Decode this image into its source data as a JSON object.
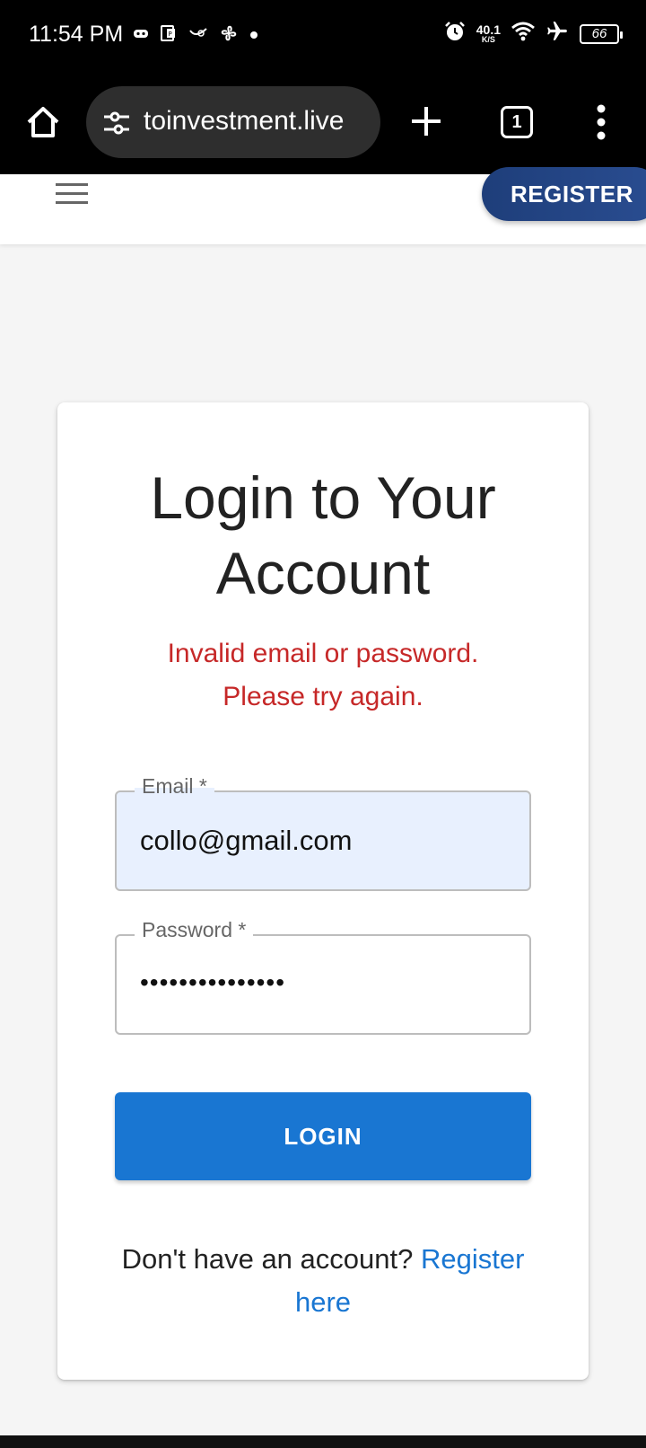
{
  "status_bar": {
    "time": "11:54 PM",
    "net_speed_value": "40.1",
    "net_speed_unit": "K/S",
    "battery": "66",
    "icons": [
      "game-icon",
      "pdf-icon",
      "whatsapp-icon",
      "fan-icon",
      "dot-icon",
      "alarm-icon",
      "wifi-icon",
      "airplane-icon",
      "battery-icon"
    ]
  },
  "browser": {
    "url": "toinvestment.live",
    "tab_count": "1",
    "icons": [
      "home-icon",
      "tune-icon",
      "plus-icon",
      "tabs-icon",
      "more-vert-icon"
    ]
  },
  "header": {
    "register_label": "REGISTER",
    "accent_color": "#1e3e7a"
  },
  "login": {
    "title_line1": "Login to Your",
    "title_line2": "Account",
    "error_line1": "Invalid email or password.",
    "error_line2": "Please try again.",
    "error_color": "#c62828",
    "email_label": "Email *",
    "email_value": "collo@gmail.com",
    "password_label": "Password *",
    "password_value": "•••••••••••••••",
    "login_label": "LOGIN",
    "login_color": "#1976d2",
    "footer_prefix": "Don't have an account? ",
    "footer_link_line1": "Register",
    "footer_link_line2": "here"
  }
}
